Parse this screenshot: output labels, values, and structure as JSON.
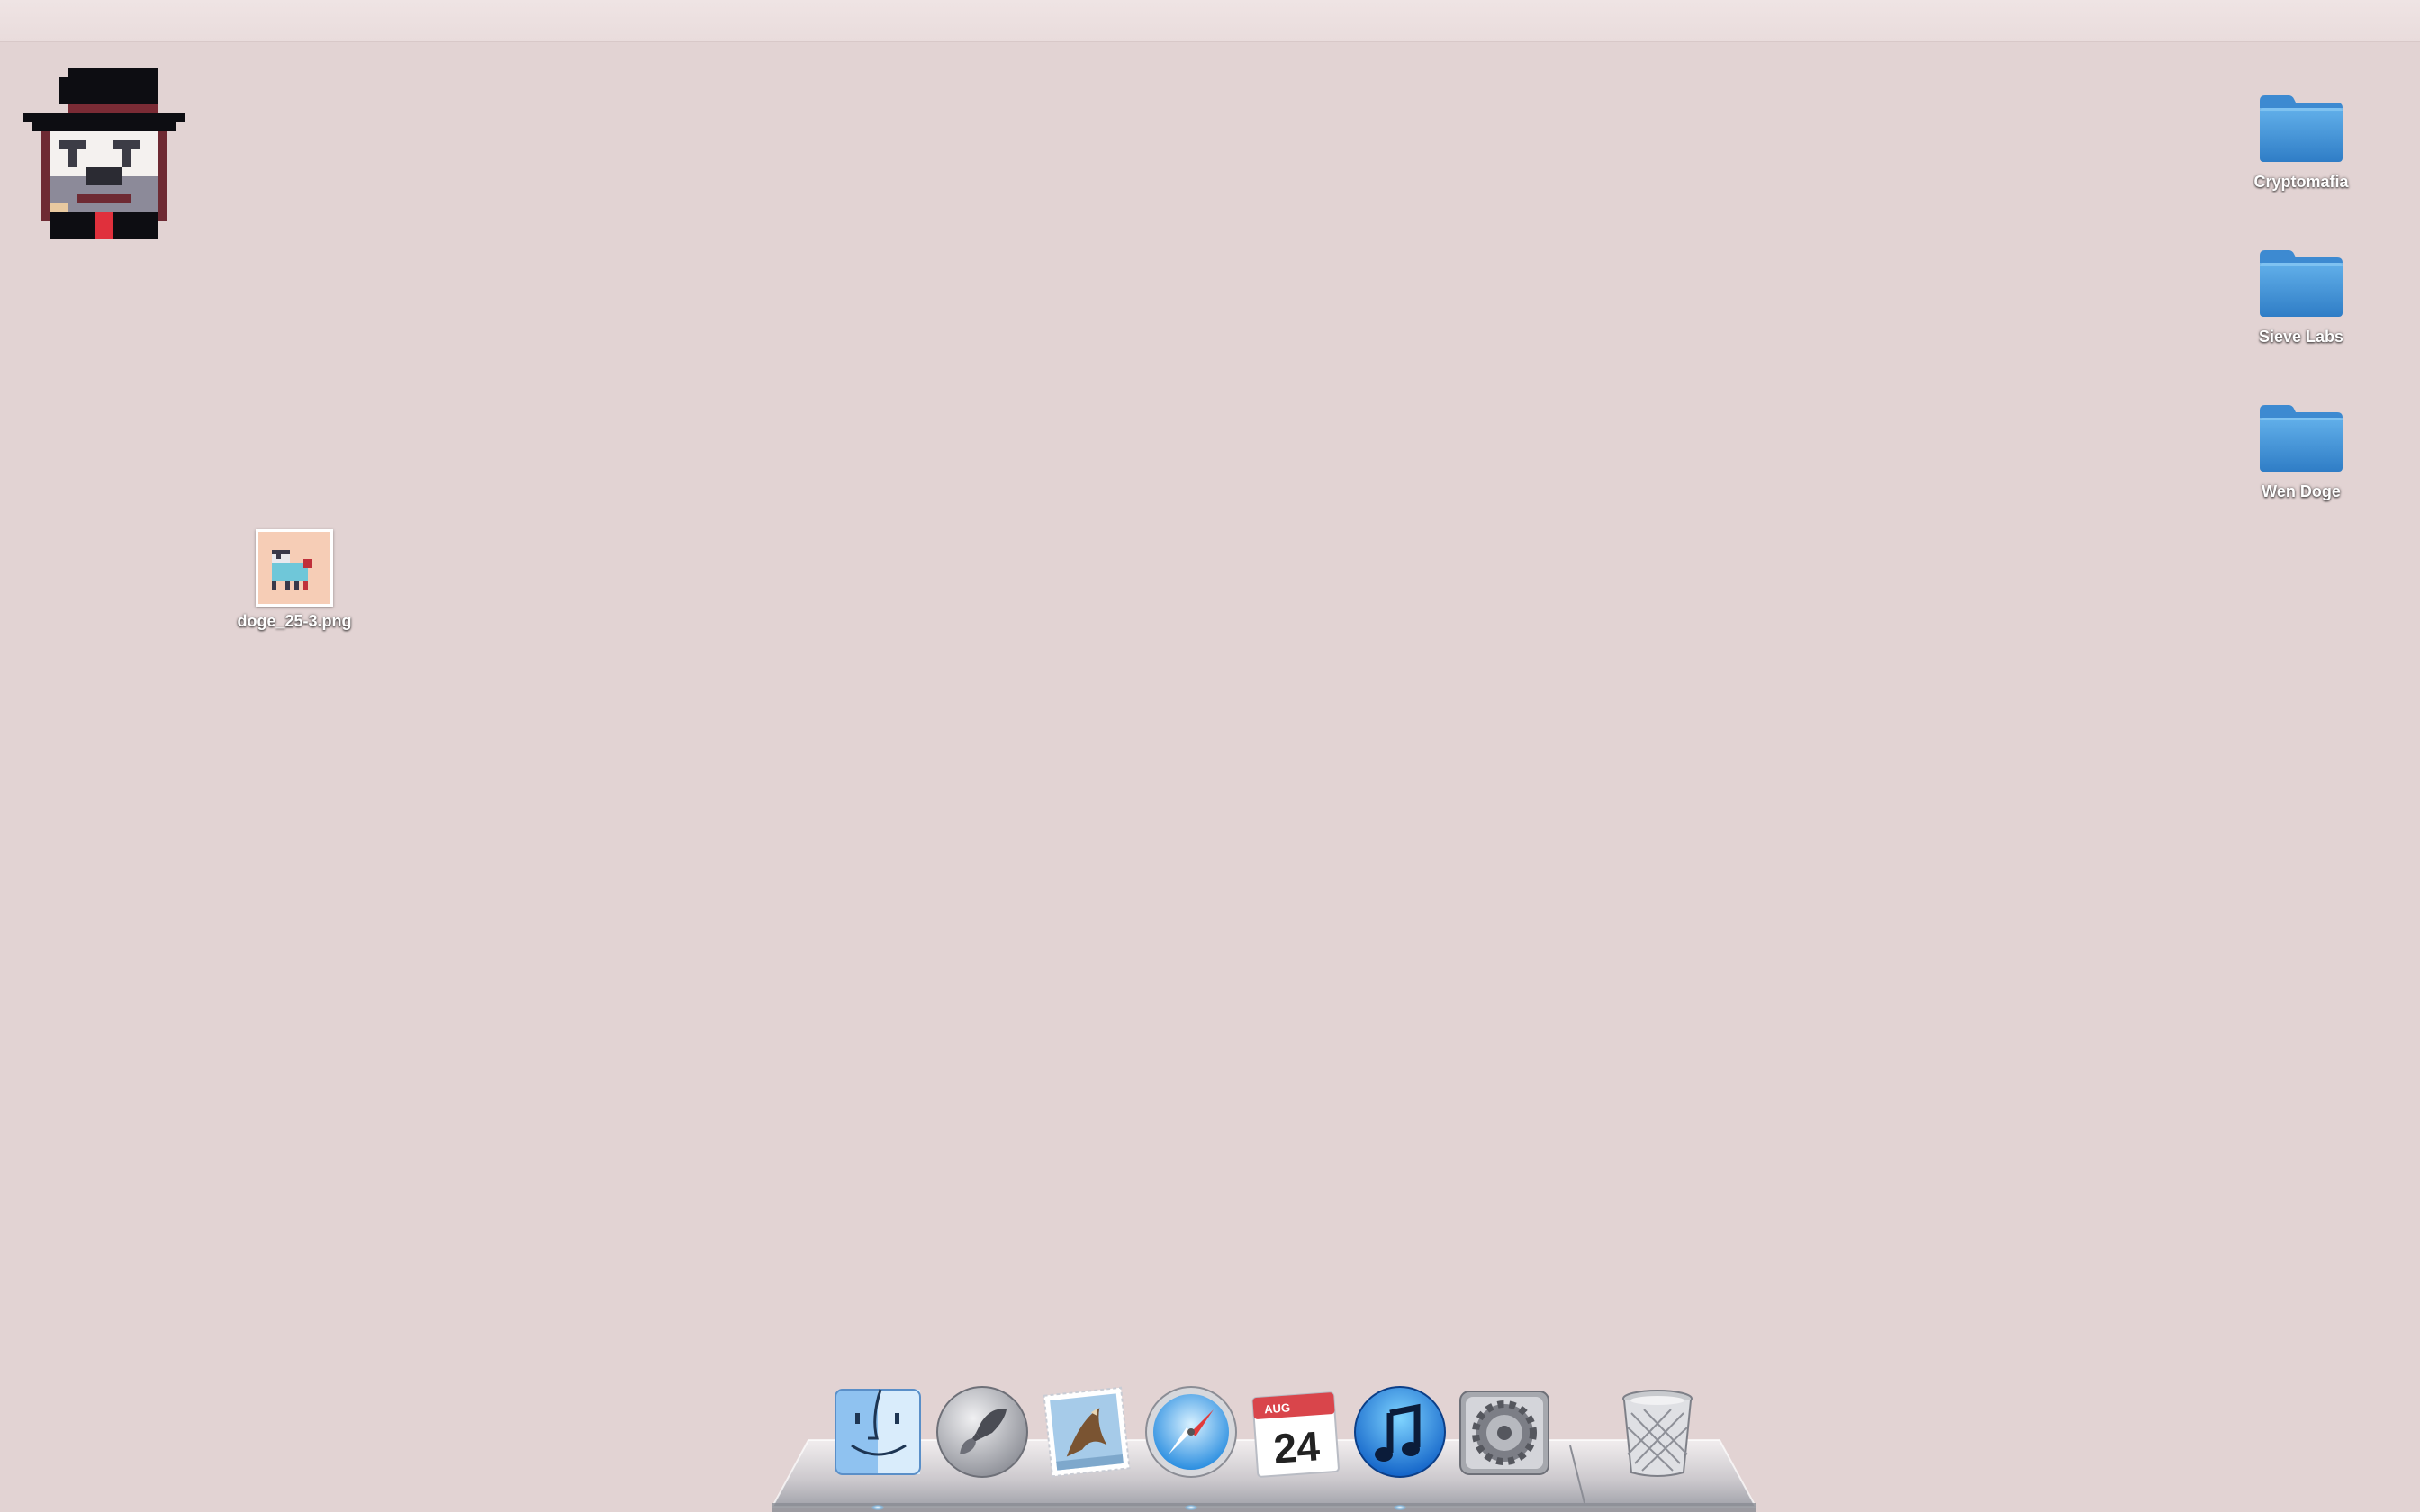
{
  "desktop": {
    "background_color": "#e2d3d3",
    "menubar_color": "#ebdfdf",
    "logo_icon": "pixel-doge-mafia-icon",
    "folders": [
      {
        "label": "Cryptomafia",
        "icon": "folder-icon"
      },
      {
        "label": "Sieve Labs",
        "icon": "folder-icon"
      },
      {
        "label": "Wen Doge",
        "icon": "folder-icon"
      }
    ],
    "files": [
      {
        "label": "doge_25-3.png",
        "icon": "image-file-icon"
      }
    ]
  },
  "dock": {
    "apps": [
      {
        "name": "Finder",
        "icon": "finder-icon",
        "running": true
      },
      {
        "name": "Launchpad",
        "icon": "launchpad-icon",
        "running": false
      },
      {
        "name": "Mail",
        "icon": "mail-icon",
        "running": false
      },
      {
        "name": "Safari",
        "icon": "safari-icon",
        "running": true
      },
      {
        "name": "Calendar",
        "icon": "calendar-icon",
        "running": false,
        "month": "AUG",
        "day": "24"
      },
      {
        "name": "iTunes",
        "icon": "itunes-icon",
        "running": true
      },
      {
        "name": "System Preferences",
        "icon": "system-preferences-icon",
        "running": false
      }
    ],
    "trash": {
      "name": "Trash",
      "icon": "trash-icon"
    }
  }
}
